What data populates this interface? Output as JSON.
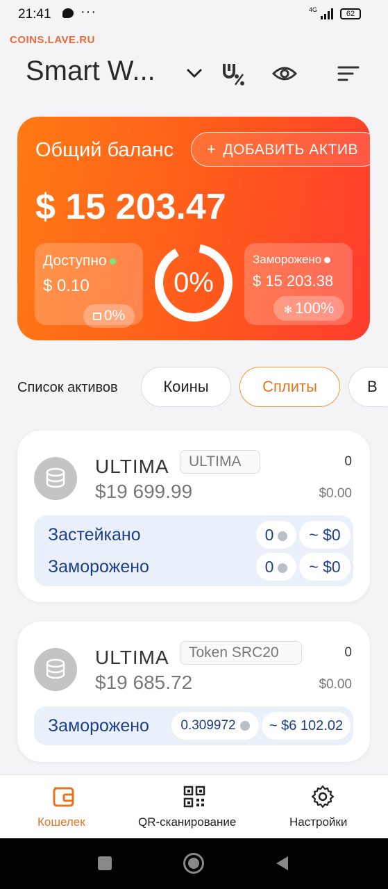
{
  "status_bar": {
    "time": "21:41",
    "network": "4G",
    "battery": "62"
  },
  "watermark": "COINS.LAVE.RU",
  "header": {
    "title": "Smart W...",
    "icons": [
      "chevron-down-icon",
      "percent-u-icon",
      "eye-icon",
      "sort-icon"
    ]
  },
  "balance_card": {
    "title": "Общий баланс",
    "add_asset_label": "ДОБАВИТЬ АКТИВ",
    "total": "$ 15 203.47",
    "available": {
      "label": "Доступно",
      "value": "$ 0.10",
      "percent": "0%"
    },
    "ring_percent": "0%",
    "ring_fraction": 0.0,
    "frozen": {
      "label": "Заморожено",
      "value": "$ 15 203.38",
      "percent": "100%"
    },
    "colors": {
      "gradient_start": "#ff7a14",
      "gradient_end": "#ff3c2e",
      "available_dot": "#7ee27e",
      "frozen_dot": "#ffffff"
    }
  },
  "filters": {
    "label": "Список активов",
    "chips": [
      {
        "label": "Коины",
        "active": false
      },
      {
        "label": "Сплиты",
        "active": true
      },
      {
        "label": "В",
        "active": false
      }
    ]
  },
  "assets": [
    {
      "name": "ULTIMA",
      "tag": "ULTIMA",
      "price": "$19 699.99",
      "amount": "0",
      "amount_usd": "$0.00",
      "rows": [
        {
          "label": "Застейкано",
          "qty": "0",
          "usd": "~ $0"
        },
        {
          "label": "Заморожено",
          "qty": "0",
          "usd": "~ $0"
        }
      ]
    },
    {
      "name": "ULTIMA",
      "tag": "Token SRC20",
      "price": "$19 685.72",
      "amount": "0",
      "amount_usd": "$0.00",
      "rows": [
        {
          "label": "Заморожено",
          "qty": "0.309972",
          "usd": "~ $6 102.02"
        }
      ]
    }
  ],
  "tabbar": {
    "tabs": [
      {
        "label": "Кошелек",
        "icon": "wallet-icon",
        "active": true
      },
      {
        "label": "QR-сканирование",
        "icon": "qr-icon",
        "active": false
      },
      {
        "label": "Настройки",
        "icon": "gear-icon",
        "active": false
      }
    ],
    "active_color": "#e6731f"
  },
  "system_nav": {
    "icons": [
      "square-icon",
      "home-circle-icon",
      "back-triangle-icon"
    ]
  }
}
